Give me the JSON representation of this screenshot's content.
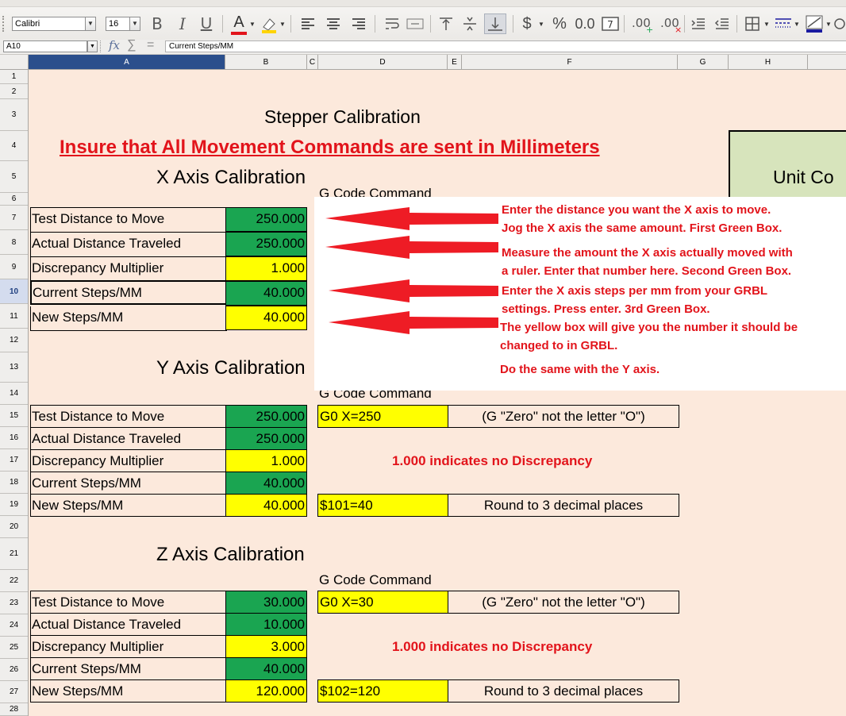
{
  "toolbar": {
    "font_name": "Calibri",
    "font_size": "16",
    "bold_label": "B",
    "italic_label": "I",
    "underline_label": "U",
    "font_color_label": "A",
    "currency_label": "$",
    "percent_label": "%",
    "number_label": "0.0",
    "icon_names": [
      "bold-icon",
      "italic-icon",
      "underline-icon",
      "font-color-icon",
      "highlight-icon",
      "align-left-icon",
      "align-center-icon",
      "align-right-icon",
      "wrap-icon",
      "merge-icon",
      "align-top-icon",
      "align-middle-icon",
      "align-bottom-icon",
      "currency-icon",
      "percent-icon",
      "number-format-icon",
      "date-icon",
      "add-decimal-icon",
      "delete-decimal-icon",
      "indent-icon",
      "outdent-icon",
      "borders-icon",
      "border-style-icon",
      "border-color-icon"
    ],
    "colors": {
      "font_color": "#e2141b",
      "highlight": "#ffd400",
      "border_color": "#1a1aa0"
    }
  },
  "formula_bar": {
    "name_box": "A10",
    "content": "Current Steps/MM",
    "fx_label": "fx",
    "sum_label": "∑",
    "equals_label": "="
  },
  "columns": [
    "A",
    "B",
    "C",
    "D",
    "E",
    "F",
    "G",
    "H"
  ],
  "rows": [
    "1",
    "2",
    "3",
    "4",
    "5",
    "6",
    "7",
    "8",
    "9",
    "10",
    "11",
    "12",
    "13",
    "14",
    "15",
    "16",
    "17",
    "18",
    "19",
    "20",
    "21",
    "22",
    "23",
    "24",
    "25",
    "26",
    "27",
    "28"
  ],
  "selected": {
    "column": "A",
    "row": "10"
  },
  "sheet": {
    "title": "Stepper Calibration",
    "warning": "Insure that All Movement Commands are sent in Millimeters",
    "unit_box": "Unit Co",
    "x_axis": {
      "heading": "X Axis Calibration",
      "gcode_header_partial": "G Code Command",
      "rows": [
        {
          "label": "Test Distance to Move",
          "value": "250.000",
          "fill": "green"
        },
        {
          "label": "Actual Distance Traveled",
          "value": "250.000",
          "fill": "green"
        },
        {
          "label": "Discrepancy Multiplier",
          "value": "1.000",
          "fill": "yellow"
        },
        {
          "label": "Current Steps/MM",
          "value": "40.000",
          "fill": "green"
        },
        {
          "label": "New Steps/MM",
          "value": "40.000",
          "fill": "yellow"
        }
      ]
    },
    "y_axis": {
      "heading": "Y Axis Calibration",
      "gcode_header": "G Code Command",
      "rows": [
        {
          "label": "Test Distance to Move",
          "value": "250.000",
          "fill": "green"
        },
        {
          "label": "Actual Distance Traveled",
          "value": "250.000",
          "fill": "green"
        },
        {
          "label": "Discrepancy Multiplier",
          "value": "1.000",
          "fill": "yellow"
        },
        {
          "label": "Current Steps/MM",
          "value": "40.000",
          "fill": "green"
        },
        {
          "label": "New Steps/MM",
          "value": "40.000",
          "fill": "yellow"
        }
      ],
      "gcode_command": "G0 X=250",
      "gcode_note": "(G \"Zero\" not the letter \"O\")",
      "discrepancy_note": "1.000 indicates no Discrepancy",
      "steps_command": "$101=40",
      "round_note": "Round to 3 decimal places"
    },
    "z_axis": {
      "heading": "Z Axis Calibration",
      "gcode_header": "G Code Command",
      "rows": [
        {
          "label": "Test Distance to Move",
          "value": "30.000",
          "fill": "green"
        },
        {
          "label": "Actual Distance Traveled",
          "value": "10.000",
          "fill": "green"
        },
        {
          "label": "Discrepancy Multiplier",
          "value": "3.000",
          "fill": "yellow"
        },
        {
          "label": "Current Steps/MM",
          "value": "40.000",
          "fill": "green"
        },
        {
          "label": "New Steps/MM",
          "value": "120.000",
          "fill": "yellow"
        }
      ],
      "gcode_command": "G0 X=30",
      "gcode_note": "(G \"Zero\" not the letter \"O\")",
      "discrepancy_note": "1.000 indicates no Discrepancy",
      "steps_command": "$102=120",
      "round_note": "Round to 3 decimal places"
    }
  },
  "callout": {
    "lines": [
      "Enter the distance you want the X axis to move.",
      "Jog the X axis the same amount. First Green Box.",
      "Measure the amount the X axis actually moved with",
      "a ruler. Enter that number here.  Second Green Box.",
      "Enter the X axis steps per mm from your GRBL",
      "settings. Press enter. 3rd Green Box.",
      "The yellow box will give you the number it should be",
      "changed to in GRBL.",
      "Do the same with the Y axis."
    ]
  },
  "colors": {
    "sheet_background": "#fce9dc",
    "green_fill": "#1aa551",
    "yellow_fill": "#ffff00",
    "accent_red": "#e2141b",
    "unit_box_fill": "#d7e4bc",
    "selection_header": "#2b4f8c"
  }
}
